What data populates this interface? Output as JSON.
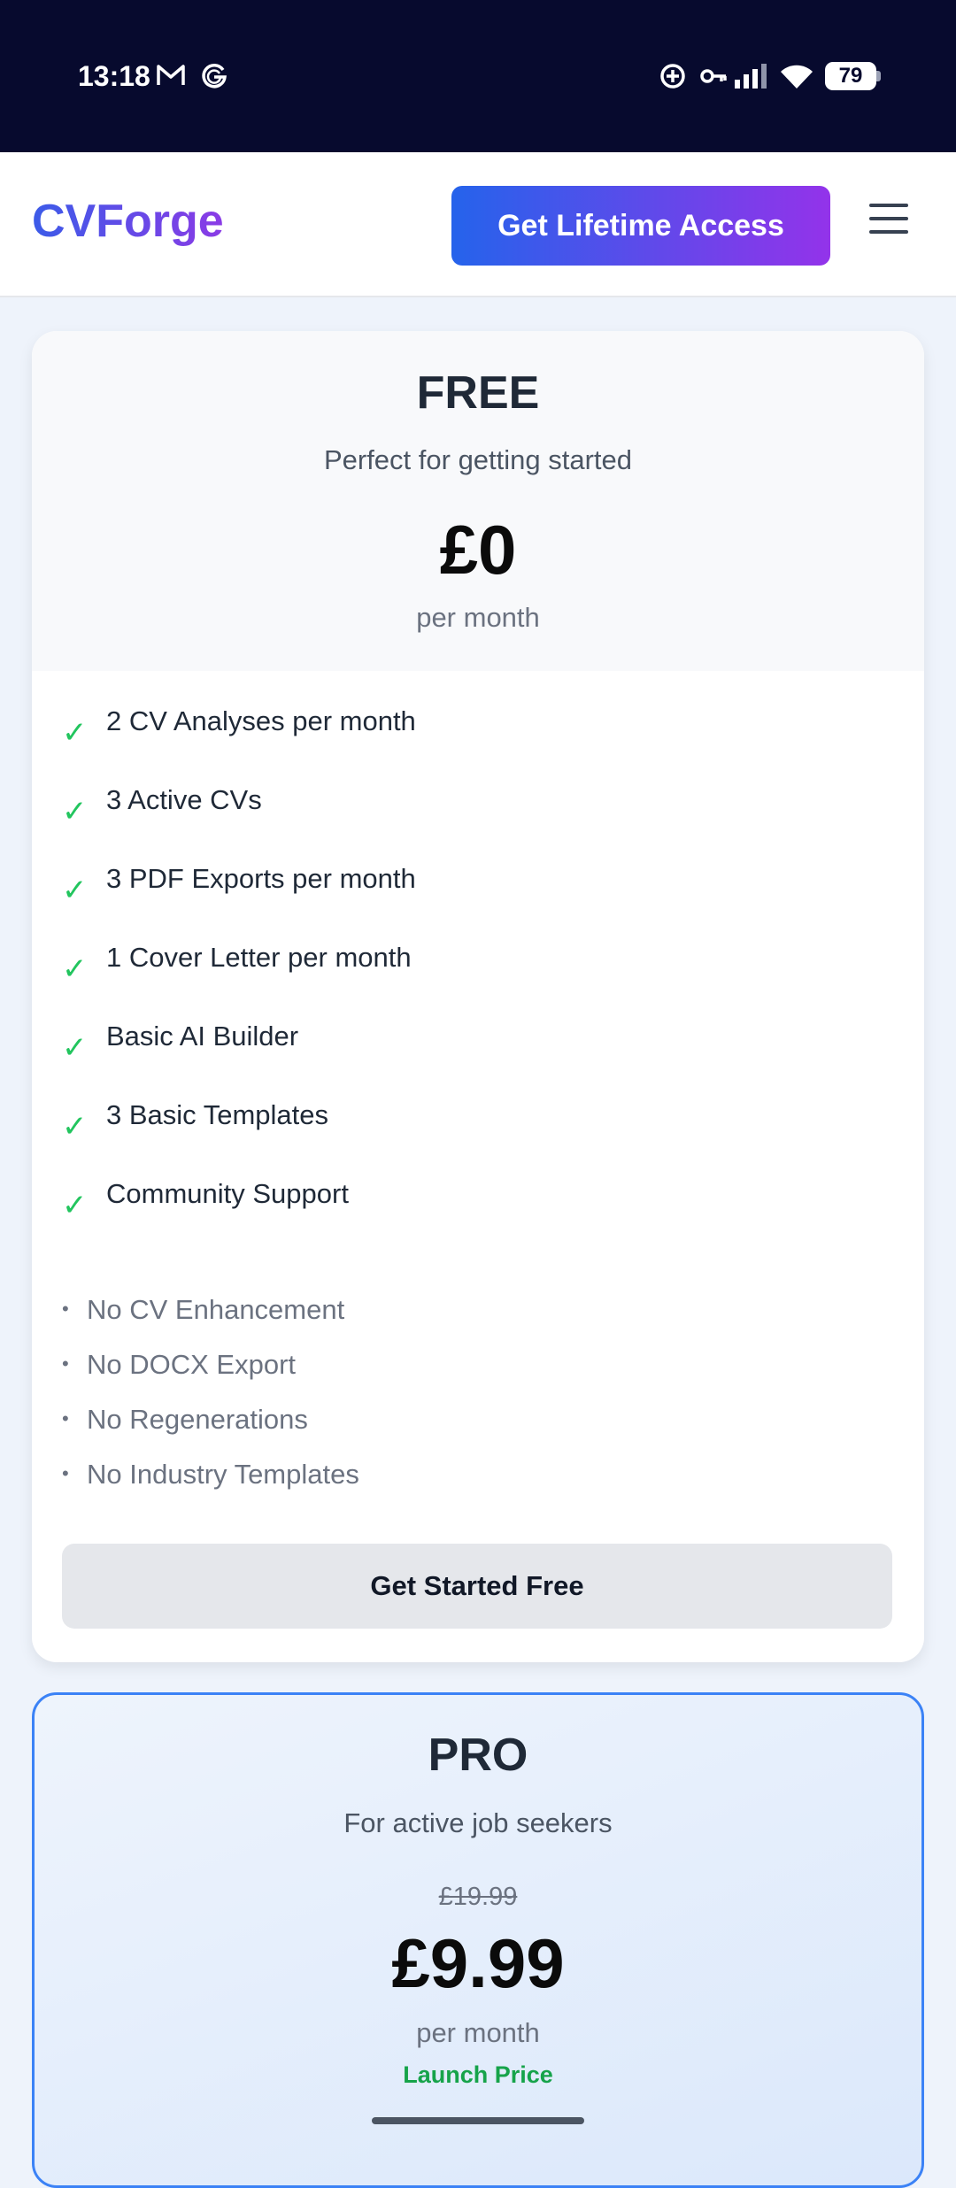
{
  "status_bar": {
    "time": "13:18",
    "battery": "79",
    "icons": [
      "gmail-icon",
      "google-icon",
      "sync-icon",
      "key-icon",
      "signal-icon",
      "wifi-icon",
      "battery-icon"
    ]
  },
  "header": {
    "logo": "CVForge",
    "cta_label": "Get Lifetime Access",
    "menu_icon": "hamburger-menu-icon"
  },
  "free_plan": {
    "name": "FREE",
    "subtitle": "Perfect for getting started",
    "price": "£0",
    "period": "per month",
    "features": [
      "2 CV Analyses per month",
      "3 Active CVs",
      "3 PDF Exports per month",
      "1 Cover Letter per month",
      "Basic AI Builder",
      "3 Basic Templates",
      "Community Support"
    ],
    "limitations": [
      "No CV Enhancement",
      "No DOCX Export",
      "No Regenerations",
      "No Industry Templates"
    ],
    "button_label": "Get Started Free"
  },
  "pro_plan": {
    "name": "PRO",
    "subtitle": "For active job seekers",
    "original_price": "£19.99",
    "price": "£9.99",
    "period": "per month",
    "badge": "Launch Price"
  },
  "colors": {
    "status_bar_bg": "#070a2e",
    "brand_gradient_start": "#2563eb",
    "brand_gradient_end": "#9333ea",
    "check_green": "#22c55e",
    "launch_green": "#16a34a",
    "pro_border": "#3b82f6"
  }
}
